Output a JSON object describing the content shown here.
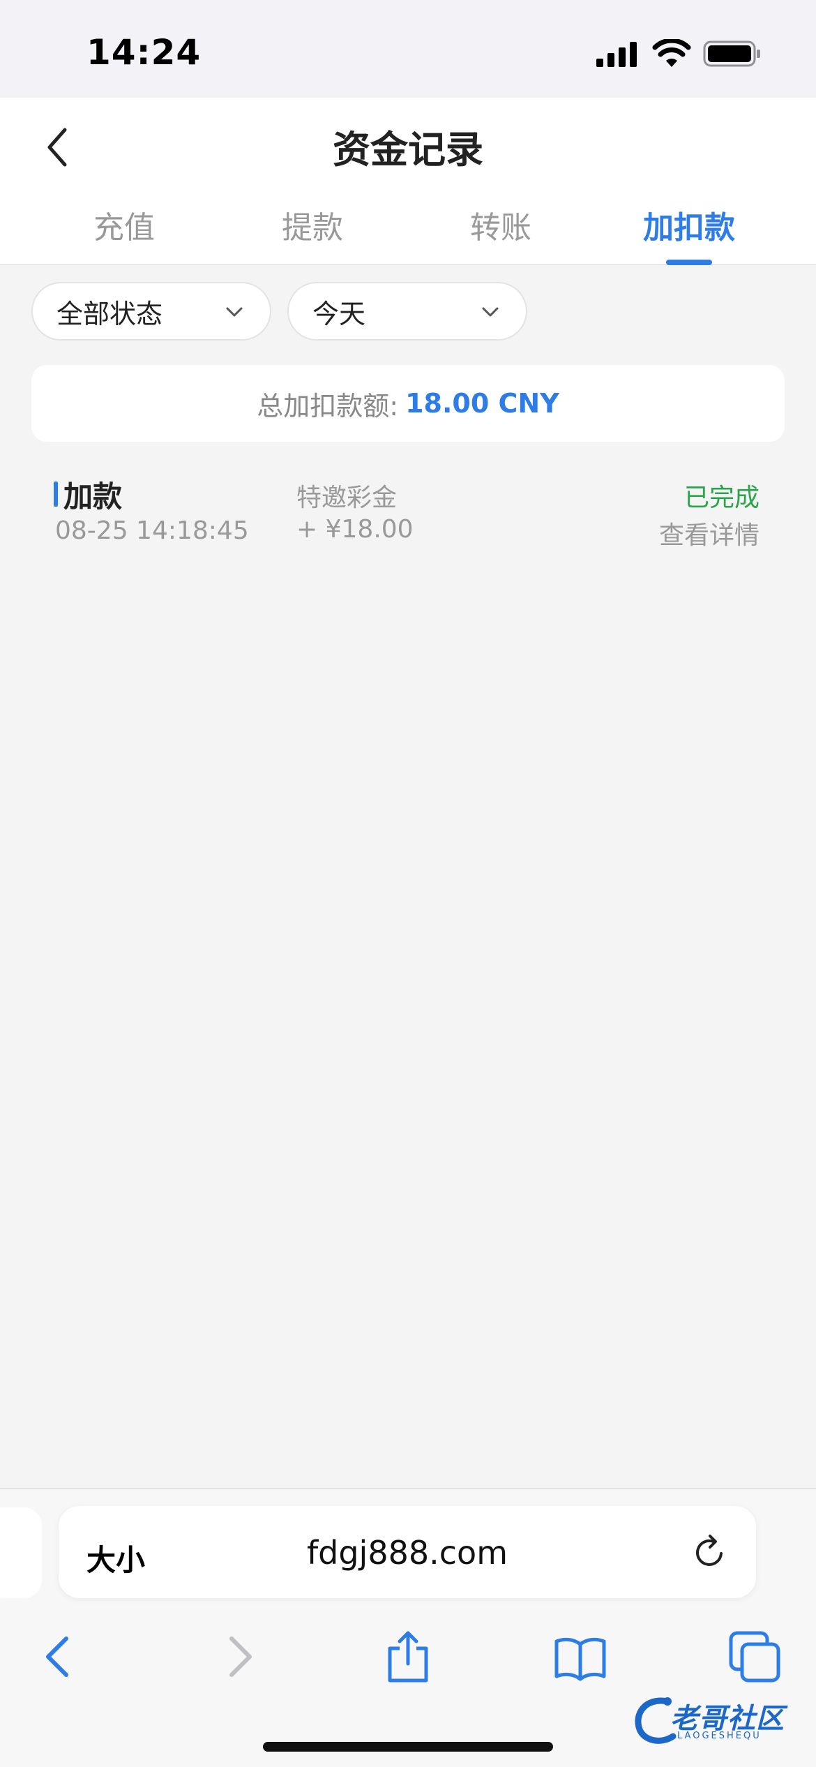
{
  "status_bar": {
    "time": "14:24"
  },
  "header": {
    "title": "资金记录",
    "tabs": [
      {
        "label": "充值"
      },
      {
        "label": "提款"
      },
      {
        "label": "转账"
      },
      {
        "label": "加扣款"
      }
    ],
    "active_tab": 3
  },
  "filters": {
    "status": "全部状态",
    "date": "今天"
  },
  "summary": {
    "label": "总加扣款额:",
    "amount": "18.00 CNY"
  },
  "records": [
    {
      "type": "加款",
      "time": "08-25 14:18:45",
      "source": "特邀彩金",
      "amount": "+ ¥18.00",
      "status": "已完成",
      "detail_label": "查看详情"
    }
  ],
  "browser": {
    "text_size_label": "大小",
    "url": "fdgj888.com"
  },
  "watermark": {
    "text": "老哥社区",
    "sub": "LAOGESHEQU"
  },
  "colors": {
    "accent": "#2e7ce6",
    "success": "#2aa54a",
    "muted": "#999999",
    "background": "#f4f4f5"
  }
}
